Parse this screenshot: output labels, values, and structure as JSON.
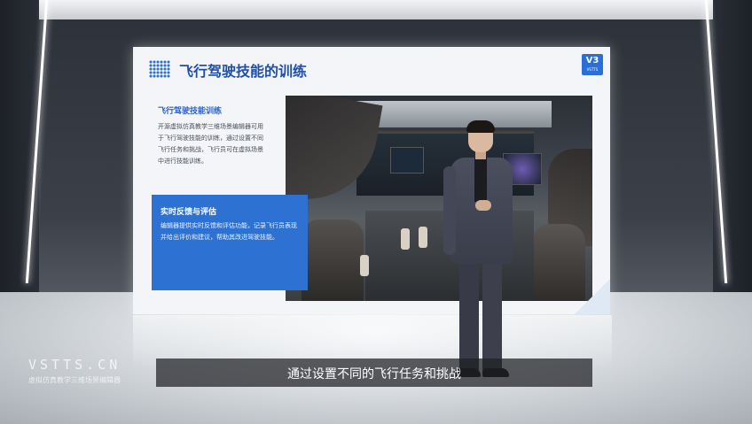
{
  "slide": {
    "title": "飞行驾驶技能的训练",
    "logo_mark": "V3",
    "logo_text": "VSTTS",
    "section1": {
      "title": "飞行驾驶技能训练",
      "body": "开源虚拟仿真教学三维场景编辑器可用于飞行驾驶技能的训练，通过设置不同飞行任务和挑战，飞行员可在虚拟场景中进行技能训练。"
    },
    "section2": {
      "title": "实时反馈与评估",
      "body": "编辑器提供实时反馈和评估功能，记录飞行员表现并给出评价和建议，帮助其改进驾驶技能。"
    }
  },
  "subtitle": "通过设置不同的飞行任务和挑战",
  "watermark": {
    "brand": "VSTTS.CN",
    "tagline": "虚拟仿真教学三维场景编辑器"
  },
  "colors": {
    "accent": "#2d72d2",
    "title_blue": "#1f4fa8"
  }
}
